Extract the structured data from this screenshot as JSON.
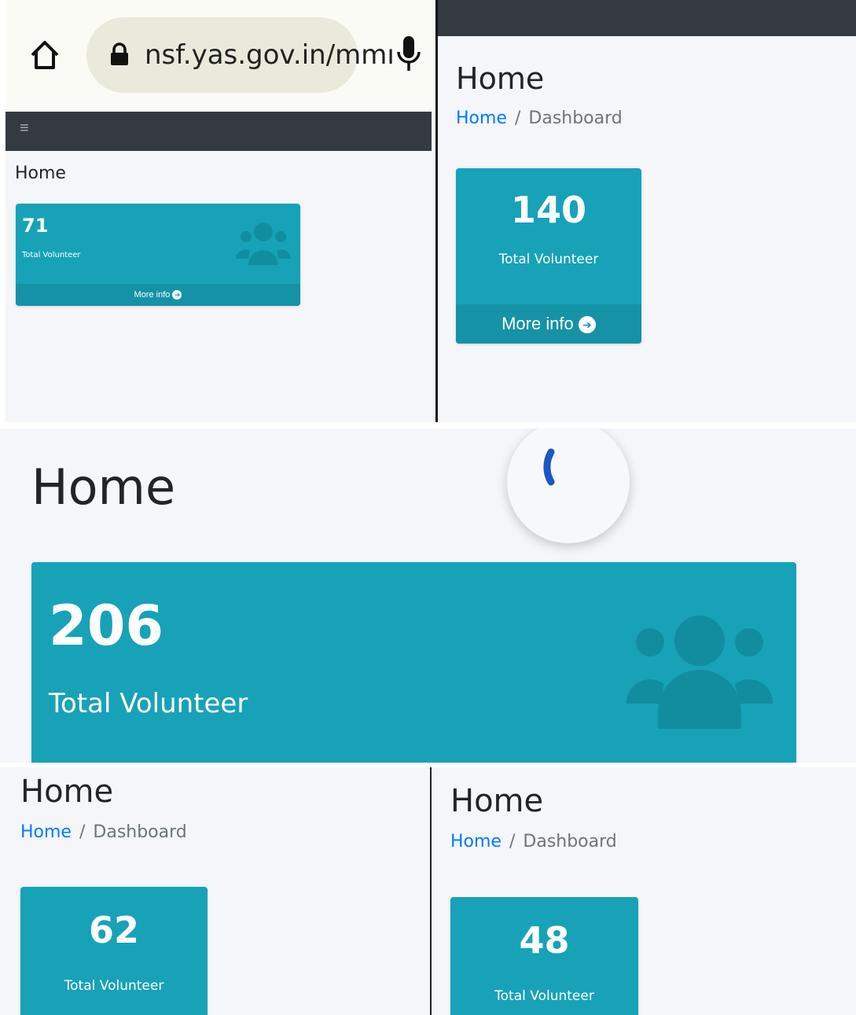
{
  "panel_a": {
    "url": "nsf.yas.gov.in/mmı",
    "menu_icon": "≡",
    "page_title": "Home",
    "card": {
      "value": "71",
      "label": "Total Volunteer",
      "more": "More info"
    }
  },
  "panel_b": {
    "page_title": "Home",
    "breadcrumb": {
      "home": "Home",
      "sep": "/",
      "current": "Dashboard"
    },
    "card": {
      "value": "140",
      "label": "Total Volunteer",
      "more": "More info"
    }
  },
  "panel_c": {
    "page_title": "Home",
    "card": {
      "value": "206",
      "label": "Total Volunteer"
    }
  },
  "panel_d": {
    "page_title": "Home",
    "breadcrumb": {
      "home": "Home",
      "sep": "/",
      "current": "Dashboard"
    },
    "card": {
      "value": "62",
      "label": "Total Volunteer"
    }
  },
  "panel_e": {
    "page_title": "Home",
    "breadcrumb": {
      "home": "Home",
      "sep": "/",
      "current": "Dashboard"
    },
    "card": {
      "value": "48",
      "label": "Total Volunteer"
    }
  },
  "colors": {
    "card_bg": "#17a2b8",
    "card_footer": "#1592a6",
    "navbar": "#343a40",
    "link": "#007bff",
    "content_bg": "#f4f6f9"
  }
}
